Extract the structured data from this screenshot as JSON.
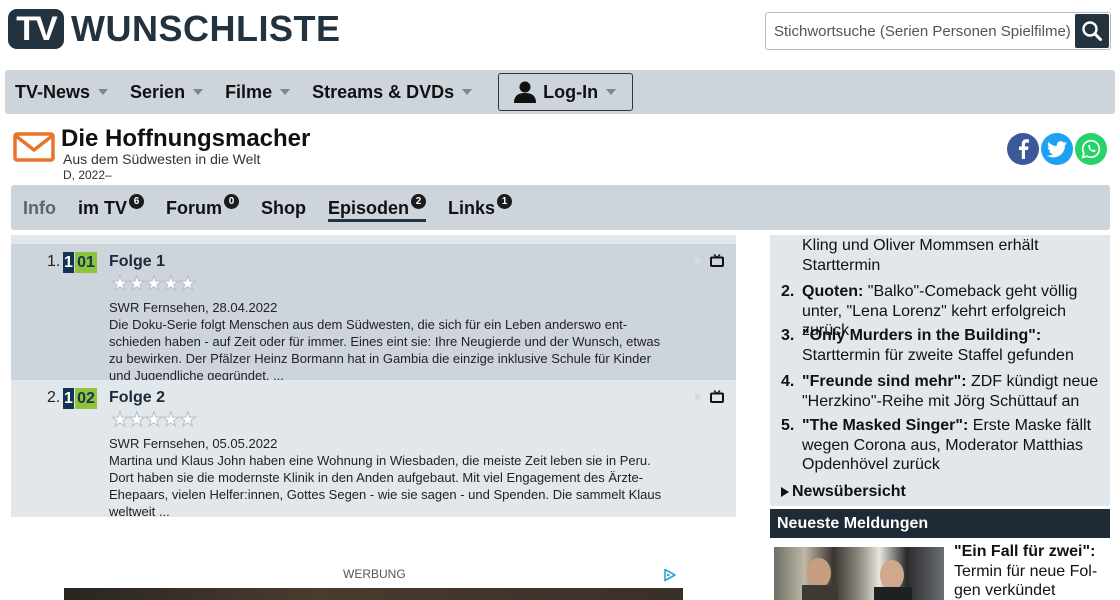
{
  "header": {
    "logo_tv": "TV",
    "logo_text": "WUNSCHLISTE",
    "search_placeholder": "Stichwortsuche (Serien Personen Spielfilme)"
  },
  "mainnav": {
    "items": [
      {
        "label": "TV-News"
      },
      {
        "label": "Serien"
      },
      {
        "label": "Filme"
      },
      {
        "label": "Streams & DVDs"
      }
    ],
    "login_label": "Log-In"
  },
  "show": {
    "title": "Die Hoffnungsmacher",
    "subtitle": "Aus dem Südwesten in die Welt",
    "year": "D, 2022–"
  },
  "subnav": {
    "info": "Info",
    "imtv": "im TV",
    "imtv_badge": "6",
    "forum": "Forum",
    "forum_badge": "0",
    "shop": "Shop",
    "episoden": "Episoden",
    "episoden_badge": "2",
    "links": "Links",
    "links_badge": "1"
  },
  "episodes": [
    {
      "num": "1.",
      "season": "1",
      "episode": "01",
      "title": "Folge 1",
      "rating_stars": 0,
      "channel_date": "SWR Fernsehen, 28.04.2022",
      "desc": "Die Doku-Serie folgt Menschen aus dem Südwesten, die sich für ein Leben anderswo ent­schieden haben - auf Zeit oder für immer. Eines eint sie: Ihre Neugierde und der Wunsch, et­was zu bewirken. Der Pfälzer Heinz Bormann hat in Gambia die einzige inklusive Schule für Kinder und Jugendliche gegründet. ..."
    },
    {
      "num": "2.",
      "season": "1",
      "episode": "02",
      "title": "Folge 2",
      "rating_stars": 0,
      "channel_date": "SWR Fernsehen, 05.05.2022",
      "desc": "Martina und Klaus John haben eine Wohnung in Wiesbaden, die meiste Zeit leben sie in Peru. Dort haben sie die modernste Klinik in den Anden aufgebaut. Mit viel Engagement des Ärzte-Ehepaars, vielen Helfer:innen, Gottes Segen - wie sie sagen - und Spenden. Die sam­melt Klaus weltweit ..."
    }
  ],
  "ad": {
    "label": "WERBUNG"
  },
  "sidebar": {
    "top_fragment": "Kling und Oliver Mommsen erhält Starttermin",
    "news": [
      {
        "num": "2.",
        "bold": "Quoten:",
        "text": " \"Balko\"-Comeback geht völlig un­ter, \"Lena Lorenz\" kehrt erfolgreich zurück"
      },
      {
        "num": "3.",
        "bold": "\"Only Murders in the Building\":",
        "text": " Startter­min für zweite Staffel gefunden"
      },
      {
        "num": "4.",
        "bold": "\"Freunde sind mehr\":",
        "text": " ZDF kündigt neue \"Herzkino\"-Reihe mit Jörg Schüttauf an"
      },
      {
        "num": "5.",
        "bold": "\"The Masked Singer\":",
        "text": " Erste Maske fällt wegen Corona aus, Moderator Matthias Opdenhövel zurück"
      }
    ],
    "news_overview": "Newsübersicht",
    "latest_heading": "Neueste Meldungen",
    "latest_bold": "\"Ein Fall für zwei\":",
    "latest_text": " Termin für neue Fol­gen verkündet"
  },
  "colors": {
    "nav_bg": "#cdd4dc",
    "dark": "#23323f",
    "season_bg": "#0f3553",
    "episode_bg": "#8fc43a",
    "mail_orange": "#e8742a",
    "facebook": "#3b5998",
    "twitter": "#1da1f2",
    "whatsapp": "#25d366"
  }
}
